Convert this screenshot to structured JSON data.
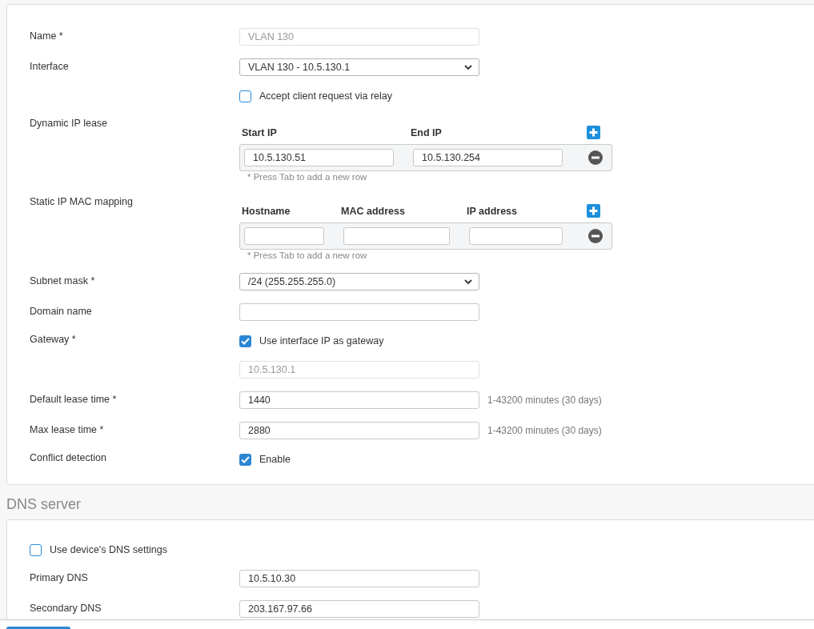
{
  "dhcp_form": {
    "fields": [
      {
        "kind": "text",
        "label": "Name *",
        "value": "VLAN 130",
        "disabled": true
      },
      {
        "kind": "select",
        "label": "Interface",
        "value": "VLAN 130 - 10.5.130.1"
      },
      {
        "kind": "checkbox",
        "text": "Accept client request via relay",
        "checked": false
      },
      {
        "kind": "table",
        "label": "Dynamic IP lease",
        "columns": [
          "Start IP",
          "End IP"
        ],
        "rows": [
          {
            "values": [
              "10.5.130.51",
              "10.5.130.254"
            ]
          }
        ],
        "hint": "* Press Tab to add a new row"
      },
      {
        "kind": "table",
        "label": "Static IP MAC mapping",
        "columns": [
          "Hostname",
          "MAC address",
          "IP address"
        ],
        "hint": "* Press Tab to add a new row"
      },
      {
        "kind": "select",
        "label": "Subnet mask *",
        "value": "/24 (255.255.255.0)"
      },
      {
        "kind": "text",
        "label": "Domain name",
        "disabled": false
      },
      {
        "kind": "checkbox",
        "label": "Gateway *",
        "text": "Use interface IP as gateway",
        "checked": true
      },
      {
        "kind": "text",
        "value": "10.5.130.1",
        "disabled": true
      },
      {
        "kind": "text",
        "label": "Default lease time *",
        "value": "1440",
        "disabled": false,
        "note": "1-43200 minutes (30 days)"
      },
      {
        "kind": "text",
        "label": "Max lease time *",
        "value": "2880",
        "disabled": false,
        "note": "1-43200 minutes (30 days)"
      },
      {
        "kind": "checkbox",
        "label": "Conflict detection",
        "text": "Enable",
        "checked": true
      }
    ]
  },
  "dns_server": {
    "title": "DNS server",
    "fields": [
      {
        "kind": "wide_checkbox",
        "text": "Use device's DNS settings",
        "checked": false
      },
      {
        "kind": "text",
        "label": "Primary DNS",
        "value": "10.5.10.30",
        "disabled": false
      },
      {
        "kind": "text",
        "label": "Secondary DNS",
        "value": "203.167.97.66",
        "disabled": false
      }
    ]
  }
}
